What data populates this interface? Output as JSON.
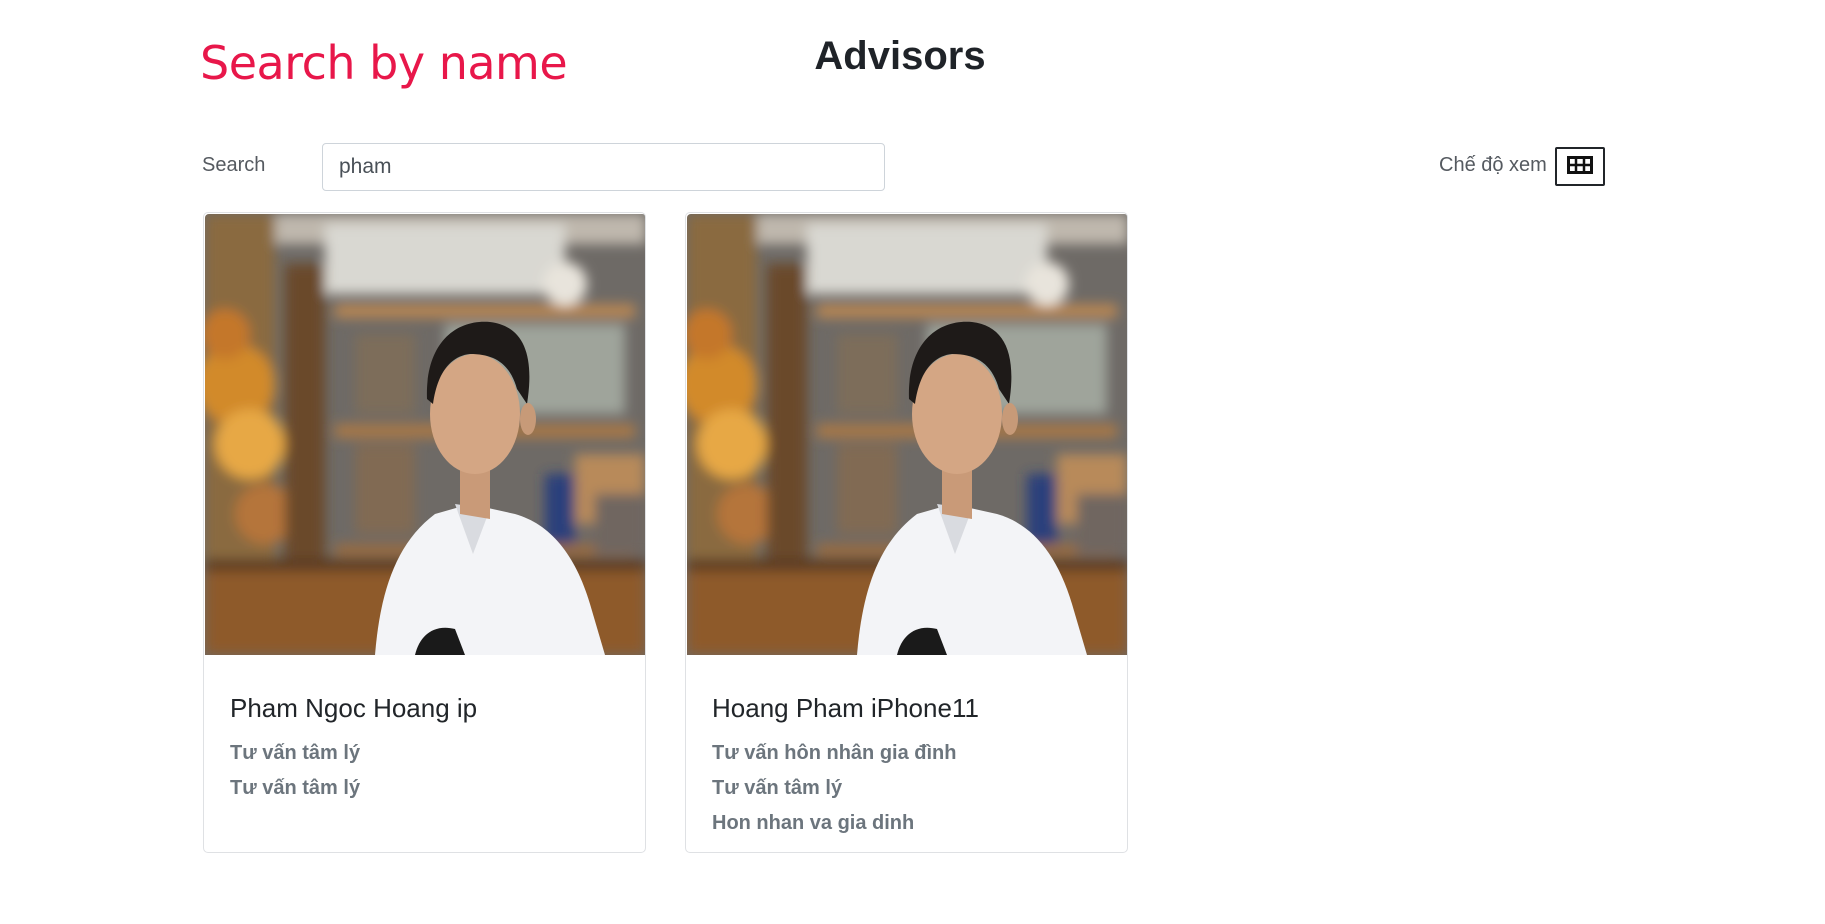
{
  "header": {
    "search_heading": "Search by name",
    "page_title": "Advisors"
  },
  "search": {
    "label": "Search",
    "value": "pham"
  },
  "view_mode": {
    "label": "Chế độ xem",
    "icon": "grid-icon"
  },
  "advisors": [
    {
      "name": "Pham Ngoc Hoang ip",
      "specialties": [
        "Tư vấn tâm lý",
        "Tư vấn tâm lý"
      ]
    },
    {
      "name": "Hoang Pham iPhone11",
      "specialties": [
        "Tư vấn hôn nhân gia đình",
        "Tư vấn tâm lý",
        "Hon nhan va gia dinh"
      ]
    }
  ],
  "colors": {
    "accent": "#e8174a",
    "text": "#212529",
    "muted": "#6c757d"
  }
}
